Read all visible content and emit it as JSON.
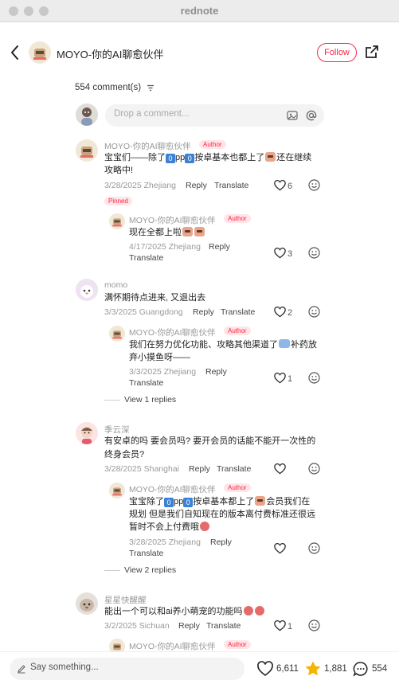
{
  "window": {
    "title": "rednote"
  },
  "header": {
    "name": "MOYO-你的AI聊愈伙伴",
    "follow": "Follow"
  },
  "comments_header": {
    "count_label": "554 comment(s)"
  },
  "comment_box": {
    "placeholder": "Drop a comment..."
  },
  "comments": [
    {
      "user": "MOYO-你的AI聊愈伙伴",
      "badge": "Author",
      "line1_a": "宝宝们——除了",
      "line1_b": "pp",
      "line1_c": "按卓基本也都上了",
      "line1_d": "还在继续",
      "line2": "攻略中!",
      "meta": "3/28/2025 Zhejiang",
      "reply": "Reply",
      "translate": "Translate",
      "likes": "6",
      "pinned": "Pinned",
      "reply_item": {
        "user": "MOYO-你的AI聊愈伙伴",
        "badge": "Author",
        "line1": "现在全都上啦",
        "meta": "4/17/2025 Zhejiang",
        "reply": "Reply",
        "translate": "Translate",
        "likes": "3"
      }
    },
    {
      "user": "momo",
      "line1": "满怀期待点进来, 又退出去",
      "meta": "3/3/2025 Guangdong",
      "reply": "Reply",
      "translate": "Translate",
      "likes": "2",
      "reply_item": {
        "user": "MOYO-你的AI聊愈伙伴",
        "badge": "Author",
        "line1_a": "我们在努力优化功能、攻略其他渠道了",
        "line1_b": "补药放",
        "line2": "弃小摸鱼呀——",
        "meta": "3/3/2025 Zhejiang",
        "reply": "Reply",
        "translate": "Translate",
        "likes": "1"
      },
      "view_replies": "View 1 replies"
    },
    {
      "user": "季云深",
      "line1": "有安卓的吗 要会员吗? 要开会员的话能不能开一次性的",
      "line2": "终身会员?",
      "meta": "3/28/2025 Shanghai",
      "reply": "Reply",
      "translate": "Translate",
      "reply_item": {
        "user": "MOYO-你的AI聊愈伙伴",
        "badge": "Author",
        "line1_a": "宝宝除了",
        "line1_b": "pp",
        "line1_c": "按卓基本都上了",
        "line1_d": "会员我们在",
        "line2": "规划 但是我们自知现在的版本离付费标准还很远",
        "line3": "暂时不会上付费哦",
        "meta": "3/28/2025 Zhejiang",
        "reply": "Reply",
        "translate": "Translate"
      },
      "view_replies": "View 2 replies"
    },
    {
      "user": "星星快醒醒",
      "line1": "能出一个可以和ai养小萌宠的功能吗",
      "meta": "3/2/2025 Sichuan",
      "reply": "Reply",
      "translate": "Translate",
      "likes": "1",
      "reply_item": {
        "user": "MOYO-你的AI聊愈伙伴",
        "badge": "Author"
      }
    }
  ],
  "bottom_bar": {
    "placeholder": "Say something...",
    "likes": "6,611",
    "collects": "1,881",
    "comments": "554"
  },
  "colors": {
    "accent": "#ff2442",
    "star": "#f5b400"
  }
}
